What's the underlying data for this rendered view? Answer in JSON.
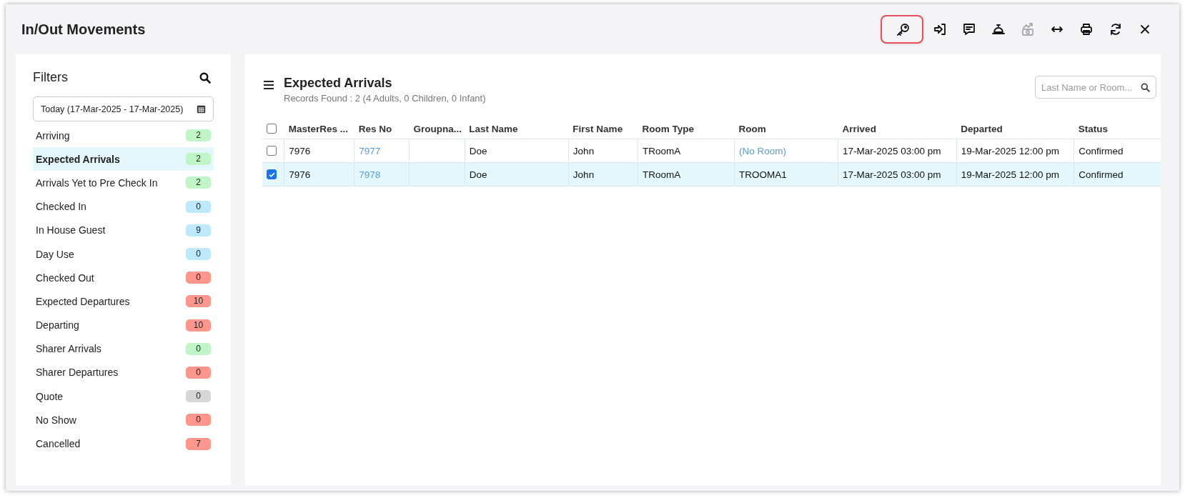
{
  "window": {
    "title": "In/Out Movements"
  },
  "toolbar": [
    {
      "highlighted": true,
      "disabled": false
    },
    {
      "highlighted": false,
      "disabled": false
    },
    {
      "highlighted": false,
      "disabled": false
    },
    {
      "highlighted": false,
      "disabled": false
    },
    {
      "highlighted": false,
      "disabled": true
    },
    {
      "highlighted": false,
      "disabled": false
    },
    {
      "highlighted": false,
      "disabled": false
    },
    {
      "highlighted": false,
      "disabled": false
    },
    {
      "highlighted": false,
      "disabled": false
    }
  ],
  "filters": {
    "title": "Filters",
    "date_range": "Today (17-Mar-2025 - 17-Mar-2025)",
    "items": [
      {
        "label": "Arriving",
        "count": "2",
        "color": "#c0f5c8",
        "selected": false
      },
      {
        "label": "Expected Arrivals",
        "count": "2",
        "color": "#c0f5c8",
        "selected": true
      },
      {
        "label": "Arrivals Yet to Pre Check In",
        "count": "2",
        "color": "#c0f5c8",
        "selected": false
      },
      {
        "label": "Checked In",
        "count": "0",
        "color": "#bde9fb",
        "selected": false
      },
      {
        "label": "In House Guest",
        "count": "9",
        "color": "#bde9fb",
        "selected": false
      },
      {
        "label": "Day Use",
        "count": "0",
        "color": "#bde9fb",
        "selected": false
      },
      {
        "label": "Checked Out",
        "count": "0",
        "color": "#fd978e",
        "selected": false
      },
      {
        "label": "Expected Departures",
        "count": "10",
        "color": "#fd978e",
        "selected": false
      },
      {
        "label": "Departing",
        "count": "10",
        "color": "#fd978e",
        "selected": false
      },
      {
        "label": "Sharer Arrivals",
        "count": "0",
        "color": "#c0f5c8",
        "selected": false
      },
      {
        "label": "Sharer Departures",
        "count": "0",
        "color": "#fd978e",
        "selected": false
      },
      {
        "label": "Quote",
        "count": "0",
        "color": "#d6d6d6",
        "selected": false
      },
      {
        "label": "No Show",
        "count": "0",
        "color": "#fd978e",
        "selected": false
      },
      {
        "label": "Cancelled",
        "count": "7",
        "color": "#fd978e",
        "selected": false
      }
    ]
  },
  "results": {
    "title": "Expected Arrivals",
    "subtitle": "Records Found : 2 (4 Adults, 0 Children, 0 Infant)",
    "search": {
      "placeholder": "Last Name or Room..."
    },
    "table": {
      "all_selected": false,
      "columns": [
        "MasterRes ...",
        "Res No",
        "Groupna...",
        "Last Name",
        "First Name",
        "Room Type",
        "Room",
        "Arrived",
        "Departed",
        "Status"
      ],
      "rows": [
        {
          "selected": false,
          "cells": [
            {
              "kind": "text",
              "text": "7976"
            },
            {
              "kind": "link",
              "text": "7977"
            },
            {
              "kind": "empty"
            },
            {
              "kind": "text",
              "text": "Doe"
            },
            {
              "kind": "text",
              "text": "John"
            },
            {
              "kind": "text",
              "text": "TRoomA"
            },
            {
              "kind": "link",
              "text": "(No Room)"
            },
            {
              "kind": "text",
              "text": "17-Mar-2025 03:00 pm"
            },
            {
              "kind": "text",
              "text": "19-Mar-2025 12:00 pm"
            },
            {
              "kind": "text",
              "text": "Confirmed"
            }
          ]
        },
        {
          "selected": true,
          "cells": [
            {
              "kind": "text",
              "text": "7976"
            },
            {
              "kind": "link",
              "text": "7978"
            },
            {
              "kind": "empty"
            },
            {
              "kind": "text",
              "text": "Doe"
            },
            {
              "kind": "text",
              "text": "John"
            },
            {
              "kind": "text",
              "text": "TRoomA"
            },
            {
              "kind": "text",
              "text": "TROOMA1"
            },
            {
              "kind": "text",
              "text": "17-Mar-2025 03:00 pm"
            },
            {
              "kind": "text",
              "text": "19-Mar-2025 12:00 pm"
            },
            {
              "kind": "text",
              "text": "Confirmed"
            }
          ]
        }
      ]
    }
  }
}
